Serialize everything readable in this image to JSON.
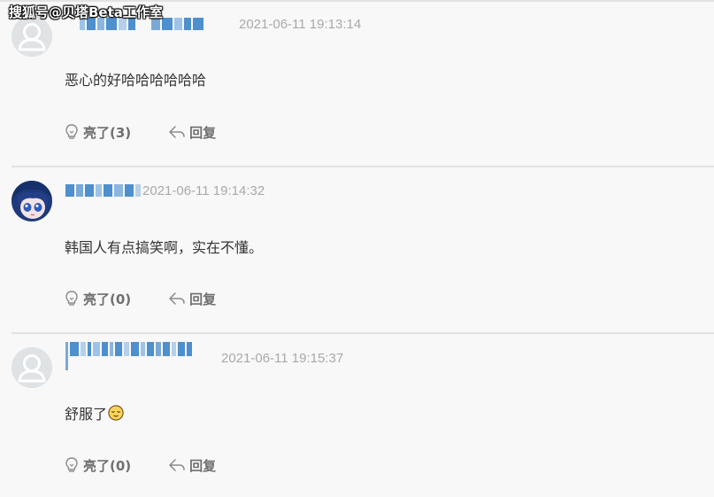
{
  "watermark": "搜狐号@贝塔Beta工作室",
  "comments": [
    {
      "timestamp": "2021-06-11 19:13:14",
      "text": "恶心的好哈哈哈哈哈哈",
      "like_label": "亮了(3)",
      "reply_label": "回复",
      "avatar": "default-avatar"
    },
    {
      "timestamp": "2021-06-11 19:14:32",
      "text": "韩国人有点搞笑啊，实在不懂。",
      "like_label": "亮了(0)",
      "reply_label": "回复",
      "avatar": "anime-avatar"
    },
    {
      "timestamp": "2021-06-11 19:15:37",
      "text": "舒服了",
      "emoji": "relieved-face-emoji",
      "like_label": "亮了(0)",
      "reply_label": "回复",
      "avatar": "default-avatar"
    }
  ],
  "colors": {
    "background": "#f8f8f8",
    "username_blue": "#4e8fce",
    "timestamp_gray": "#a9a9a9",
    "action_gray": "#6f6f6f",
    "divider": "#e2e2e2"
  },
  "icons": {
    "like": "lightbulb-icon",
    "reply": "reply-arrow-icon"
  }
}
